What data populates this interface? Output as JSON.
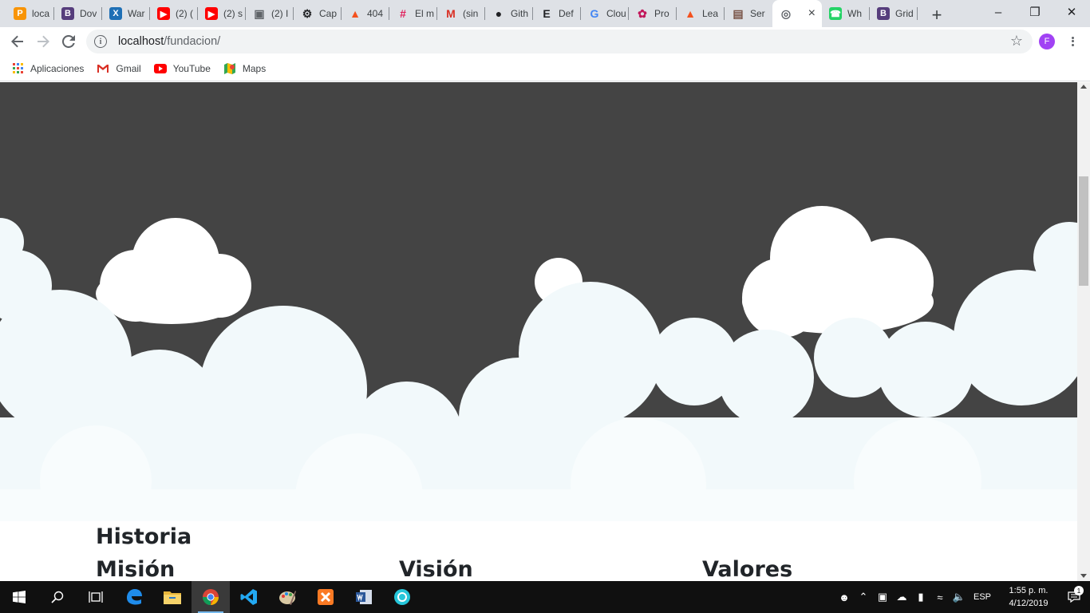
{
  "browser": {
    "tabs": [
      {
        "title": "loca",
        "icon": "phpmyadmin-icon",
        "color": "#f89406"
      },
      {
        "title": "Dov",
        "icon": "bootstrap-icon",
        "color": "#563d7c"
      },
      {
        "title": "War",
        "icon": "xampp-x-icon",
        "color": "#1e6fb5"
      },
      {
        "title": "(2) (",
        "icon": "youtube-icon",
        "color": "#ff0000"
      },
      {
        "title": "(2) s",
        "icon": "youtube-icon",
        "color": "#ff0000"
      },
      {
        "title": "(2) I",
        "icon": "discord-icon",
        "color": "#5f6368"
      },
      {
        "title": "Cap",
        "icon": "gear-icon",
        "color": "#202124"
      },
      {
        "title": "404",
        "icon": "laravel-icon",
        "color": "#f4511e"
      },
      {
        "title": "El m",
        "icon": "slack-icon",
        "color": "#e01e5a"
      },
      {
        "title": "(sin",
        "icon": "gmail-icon",
        "color": "#d93025"
      },
      {
        "title": "Gith",
        "icon": "github-icon",
        "color": "#202124"
      },
      {
        "title": "Def",
        "icon": "e-icon",
        "color": "#202124"
      },
      {
        "title": "Clou",
        "icon": "google-icon",
        "color": "#4285f4"
      },
      {
        "title": "Pro",
        "icon": "flower-icon",
        "color": "#c2185b"
      },
      {
        "title": "Lea",
        "icon": "laravel-icon",
        "color": "#f4511e"
      },
      {
        "title": "Ser",
        "icon": "server-icon",
        "color": "#795548"
      },
      {
        "title": "",
        "icon": "globe-icon",
        "color": "#5f6368",
        "active": true
      },
      {
        "title": "Wh",
        "icon": "whatsapp-icon",
        "color": "#25d366"
      },
      {
        "title": "Grid",
        "icon": "bootstrap-icon",
        "color": "#563d7c"
      }
    ],
    "new_tab": "+",
    "active_tab_close": "×",
    "url_host": "localhost",
    "url_path": "/fundacion/",
    "profile_initial": "F",
    "bookmarks": [
      {
        "label": "Aplicaciones",
        "icon": "apps-grid-icon"
      },
      {
        "label": "Gmail",
        "icon": "gmail-icon"
      },
      {
        "label": "YouTube",
        "icon": "youtube-icon"
      },
      {
        "label": "Maps",
        "icon": "maps-icon"
      }
    ]
  },
  "page": {
    "hero_bg": "#444444",
    "headings": {
      "historia": "Historia",
      "mision": "Misión",
      "vision": "Visión",
      "valores": "Valores"
    },
    "scroll_position": 0.19
  },
  "taskbar": {
    "apps": [
      {
        "name": "start",
        "icon": "windows-icon"
      },
      {
        "name": "search",
        "icon": "search-icon"
      },
      {
        "name": "task-view",
        "icon": "task-view-icon"
      },
      {
        "name": "edge",
        "icon": "edge-icon"
      },
      {
        "name": "file-explorer",
        "icon": "folder-icon"
      },
      {
        "name": "chrome",
        "icon": "chrome-icon",
        "active": true
      },
      {
        "name": "vscode",
        "icon": "vscode-icon"
      },
      {
        "name": "paint",
        "icon": "paint-icon"
      },
      {
        "name": "xampp",
        "icon": "xampp-icon"
      },
      {
        "name": "word",
        "icon": "word-icon"
      },
      {
        "name": "app",
        "icon": "gear-app-icon"
      }
    ],
    "lang": "ESP",
    "time": "1:55 p. m.",
    "date": "4/12/2019",
    "notifications": "1"
  }
}
